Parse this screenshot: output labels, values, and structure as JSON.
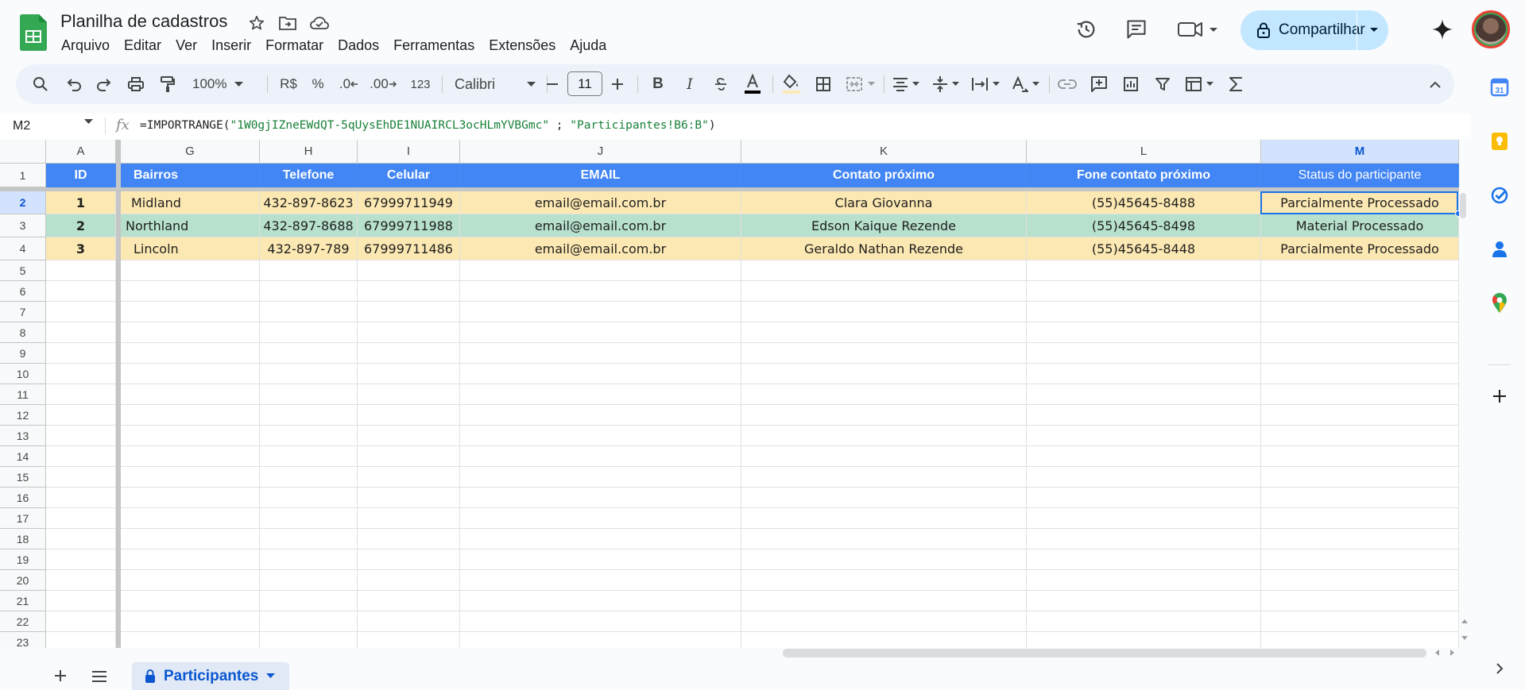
{
  "app": {
    "title": "Planilha de cadastros",
    "menu": [
      "Arquivo",
      "Editar",
      "Ver",
      "Inserir",
      "Formatar",
      "Dados",
      "Ferramentas",
      "Extensões",
      "Ajuda"
    ],
    "share_label": "Compartilhar",
    "icons": [
      "star-icon",
      "move-icon",
      "cloud-status-icon",
      "history-icon",
      "comments-icon",
      "meet-icon",
      "gemini-icon"
    ]
  },
  "toolbar": {
    "zoom": "100%",
    "currency": "R$",
    "percent": "%",
    "decrease_decimal": ".0",
    "increase_decimal": ".00",
    "number_format": "123",
    "font": "Calibri",
    "font_size": "11"
  },
  "formula_bar": {
    "name_box": "M2",
    "fx": "fx",
    "formula_prefix": "=IMPORTRANGE(",
    "formula_arg1": "\"1W0gjIZneEWdQT-5qUysEhDE1NUAIRCL3ocHLmYVBGmc\"",
    "formula_sep": " ; ",
    "formula_arg2": "\"Participantes!B6:B\"",
    "formula_suffix": ")"
  },
  "grid": {
    "columns": [
      "A",
      "G",
      "H",
      "I",
      "J",
      "K",
      "L",
      "M"
    ],
    "header_row": [
      "ID",
      "Bairros",
      "Telefone",
      "Celular",
      "EMAIL",
      "Contato próximo",
      "Fone contato próximo",
      "Status do participante"
    ],
    "rows": [
      [
        "1",
        "Midland",
        "432-897-8623",
        "67999711949",
        "email@email.com.br",
        "Clara Giovanna",
        "(55)45645-8488",
        "Parcialmente Processado"
      ],
      [
        "2",
        "Northland",
        "432-897-8688",
        "67999711988",
        "email@email.com.br",
        "Edson Kaique Rezende",
        "(55)45645-8498",
        "Material Processado"
      ],
      [
        "3",
        "Lincoln",
        "432-897-789",
        "67999711486",
        "email@email.com.br",
        "Geraldo Nathan Rezende",
        "(55)45645-8448",
        "Parcialmente Processado"
      ]
    ],
    "row_numbers": [
      "1",
      "2",
      "3",
      "4",
      "5",
      "6",
      "7",
      "8",
      "9",
      "10",
      "11",
      "12",
      "13",
      "14",
      "15",
      "16",
      "17",
      "18",
      "19",
      "20",
      "21",
      "22",
      "23"
    ]
  },
  "sheets": {
    "active": "Participantes"
  },
  "colors": {
    "header_blue": "#4285f4",
    "row_orange": "#fce8b2",
    "row_green": "#b7e1cd",
    "selection": "#1a73e8"
  }
}
